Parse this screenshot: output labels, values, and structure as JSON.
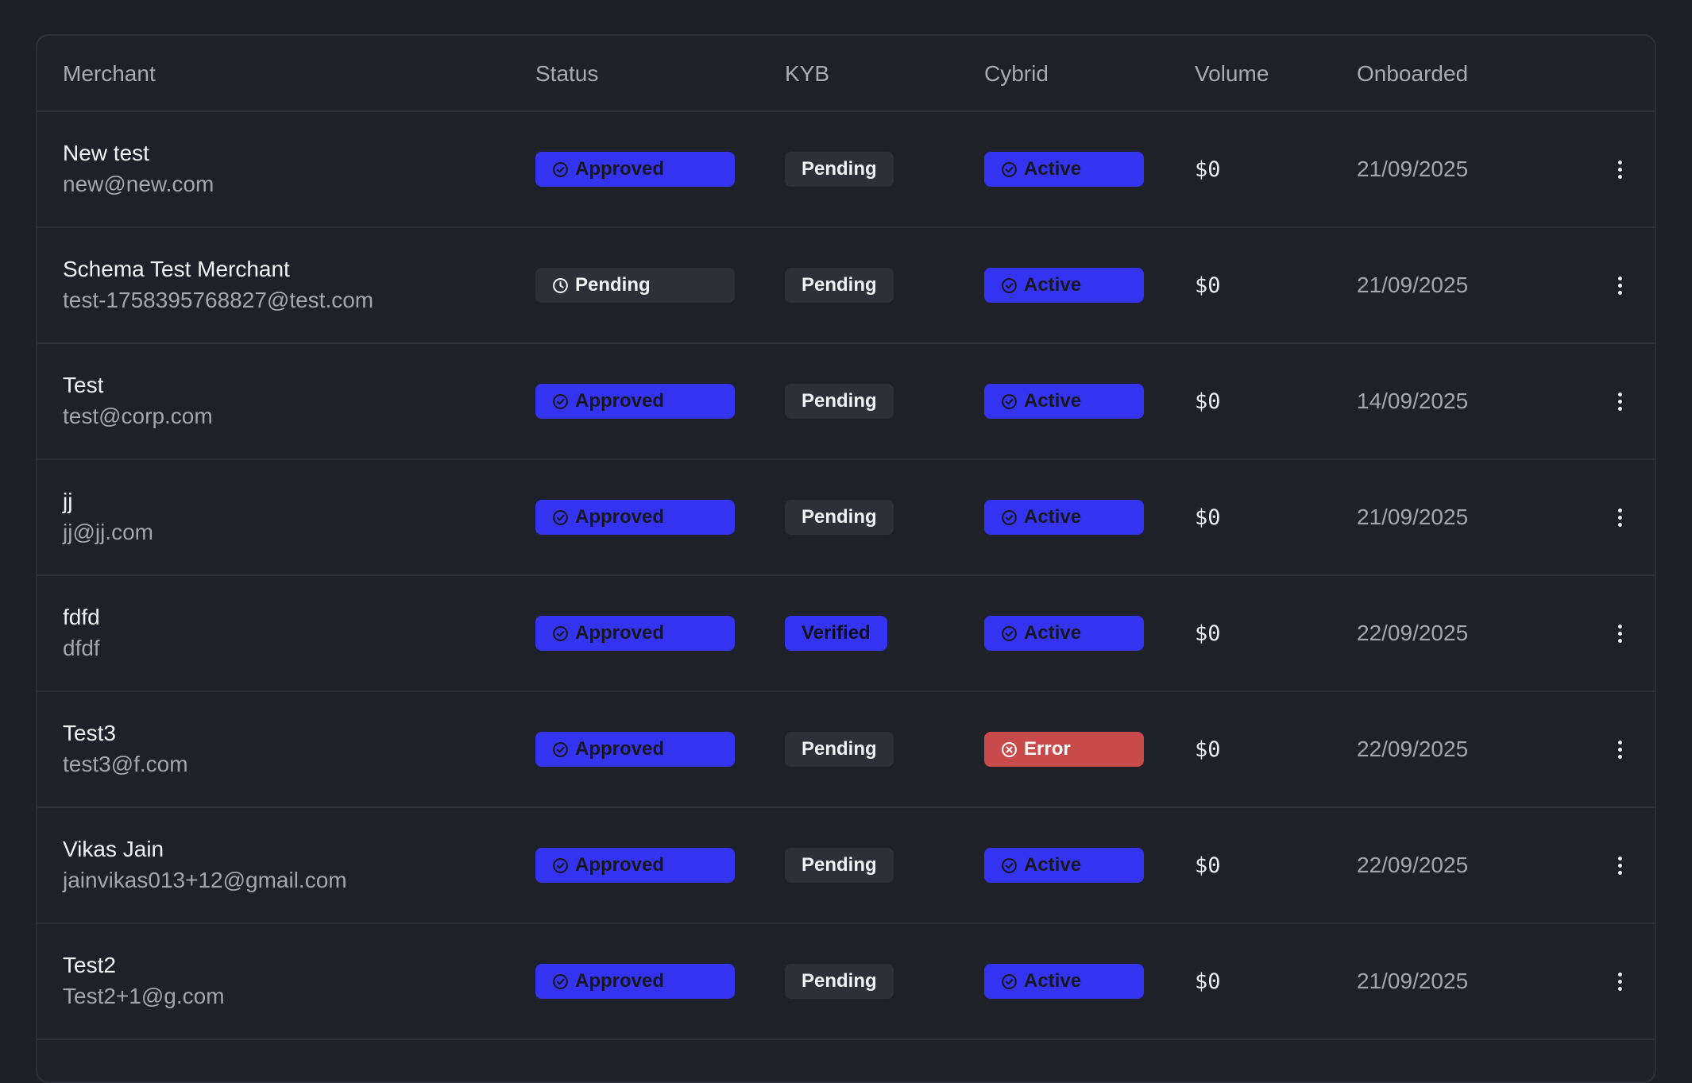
{
  "table": {
    "headers": {
      "merchant": "Merchant",
      "status": "Status",
      "kyb": "KYB",
      "cybrid": "Cybrid",
      "volume": "Volume",
      "onboarded": "Onboarded"
    },
    "rows": [
      {
        "name": "New test",
        "email": "new@new.com",
        "status": "Approved",
        "status_icon": "check-circle-icon",
        "kyb": "Pending",
        "cybrid": "Active",
        "cybrid_icon": "check-circle-icon",
        "volume": "$0",
        "onboarded": "21/09/2025"
      },
      {
        "name": "Schema Test Merchant",
        "email": "test-1758395768827@test.com",
        "status": "Pending",
        "status_icon": "clock-icon",
        "kyb": "Pending",
        "cybrid": "Active",
        "cybrid_icon": "check-circle-icon",
        "volume": "$0",
        "onboarded": "21/09/2025"
      },
      {
        "name": "Test",
        "email": "test@corp.com",
        "status": "Approved",
        "status_icon": "check-circle-icon",
        "kyb": "Pending",
        "cybrid": "Active",
        "cybrid_icon": "check-circle-icon",
        "volume": "$0",
        "onboarded": "14/09/2025"
      },
      {
        "name": "jj",
        "email": "jj@jj.com",
        "status": "Approved",
        "status_icon": "check-circle-icon",
        "kyb": "Pending",
        "cybrid": "Active",
        "cybrid_icon": "check-circle-icon",
        "volume": "$0",
        "onboarded": "21/09/2025"
      },
      {
        "name": "fdfd",
        "email": "dfdf",
        "status": "Approved",
        "status_icon": "check-circle-icon",
        "kyb": "Verified",
        "cybrid": "Active",
        "cybrid_icon": "check-circle-icon",
        "volume": "$0",
        "onboarded": "22/09/2025"
      },
      {
        "name": "Test3",
        "email": "test3@f.com",
        "status": "Approved",
        "status_icon": "check-circle-icon",
        "kyb": "Pending",
        "cybrid": "Error",
        "cybrid_icon": "x-circle-icon",
        "volume": "$0",
        "onboarded": "22/09/2025"
      },
      {
        "name": "Vikas Jain",
        "email": "jainvikas013+12@gmail.com",
        "status": "Approved",
        "status_icon": "check-circle-icon",
        "kyb": "Pending",
        "cybrid": "Active",
        "cybrid_icon": "check-circle-icon",
        "volume": "$0",
        "onboarded": "22/09/2025"
      },
      {
        "name": "Test2",
        "email": "Test2+1@g.com",
        "status": "Approved",
        "status_icon": "check-circle-icon",
        "kyb": "Pending",
        "cybrid": "Active",
        "cybrid_icon": "check-circle-icon",
        "volume": "$0",
        "onboarded": "21/09/2025"
      }
    ],
    "row_actions_icon": "more-vertical-icon"
  },
  "colors": {
    "background": "#1e2028",
    "card": "#1f2129",
    "border": "#2d3039",
    "accent_blue": "#3434f0",
    "error_red": "#c94a4a",
    "neutral_badge": "#2e3038",
    "text_primary": "#f2f3f5",
    "text_muted": "#a3a6ae"
  }
}
